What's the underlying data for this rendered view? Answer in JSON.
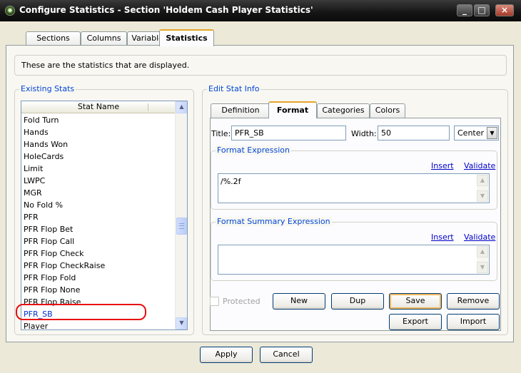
{
  "window": {
    "title": "Configure Statistics - Section 'Holdem Cash Player Statistics'"
  },
  "tabs": [
    {
      "label": "Sections"
    },
    {
      "label": "Columns"
    },
    {
      "label": "Variables"
    },
    {
      "label": "Statistics",
      "active": true
    }
  ],
  "description": "These are the statistics that are displayed.",
  "existing_stats": {
    "legend": "Existing Stats",
    "column_header": "Stat Name",
    "items": [
      "Fold Turn",
      "Hands",
      "Hands Won",
      "HoleCards",
      "Limit",
      "LWPC",
      "MGR",
      "No Fold %",
      "PFR",
      "PFR Flop Bet",
      "PFR Flop Call",
      "PFR Flop Check",
      "PFR Flop CheckRaise",
      "PFR Flop Fold",
      "PFR Flop None",
      "PFR Flop Raise",
      "PFR_SB",
      "Player"
    ],
    "selected": "PFR_SB"
  },
  "edit_stat": {
    "legend": "Edit Stat Info",
    "tabs": [
      {
        "label": "Definition"
      },
      {
        "label": "Format",
        "active": true
      },
      {
        "label": "Categories"
      },
      {
        "label": "Colors"
      }
    ],
    "title_label": "Title:",
    "title_value": "PFR_SB",
    "width_label": "Width:",
    "width_value": "50",
    "align_value": "Center",
    "format_expression": {
      "legend": "Format Expression",
      "insert": "Insert",
      "validate": "Validate",
      "value": "/%.2f"
    },
    "format_summary_expression": {
      "legend": "Format Summary Expression",
      "insert": "Insert",
      "validate": "Validate",
      "value": ""
    },
    "protected_label": "Protected",
    "buttons": {
      "new": "New",
      "dup": "Dup",
      "save": "Save",
      "remove": "Remove",
      "export": "Export",
      "import": "Import"
    }
  },
  "footer": {
    "apply": "Apply",
    "cancel": "Cancel"
  },
  "colors": {
    "legend": "#0046d5",
    "link": "#0000c8",
    "highlight": "#e80e0e",
    "tab_accent": "#e6a52b",
    "selected_item": "#0030d0"
  },
  "icons": [
    "app-icon",
    "minimize-icon",
    "maximize-icon",
    "close-icon",
    "scroll-up-icon",
    "scroll-down-icon",
    "combo-arrow-icon"
  ]
}
